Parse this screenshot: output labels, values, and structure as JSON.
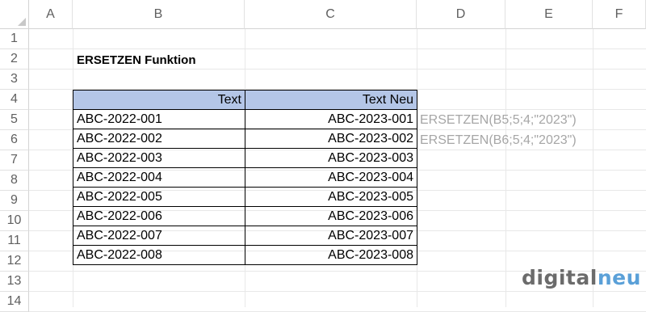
{
  "columns": [
    "A",
    "B",
    "C",
    "D",
    "E",
    "F"
  ],
  "rows": [
    "1",
    "2",
    "3",
    "4",
    "5",
    "6",
    "7",
    "8",
    "9",
    "10",
    "11",
    "12",
    "13",
    "14"
  ],
  "title": "ERSETZEN Funktion",
  "table": {
    "headers": [
      "Text",
      "Text Neu"
    ],
    "rows": [
      [
        "ABC-2022-001",
        "ABC-2023-001"
      ],
      [
        "ABC-2022-002",
        "ABC-2023-002"
      ],
      [
        "ABC-2022-003",
        "ABC-2023-003"
      ],
      [
        "ABC-2022-004",
        "ABC-2023-004"
      ],
      [
        "ABC-2022-005",
        "ABC-2023-005"
      ],
      [
        "ABC-2022-006",
        "ABC-2023-006"
      ],
      [
        "ABC-2022-007",
        "ABC-2023-007"
      ],
      [
        "ABC-2022-008",
        "ABC-2023-008"
      ]
    ]
  },
  "formulas": [
    "ERSETZEN(B5;5;4;\"2023\")",
    "ERSETZEN(B6;5;4;\"2023\")"
  ],
  "logo": {
    "part1": "digital",
    "part2": "neu",
    "color1": "#6b6b6b",
    "color2": "#5aa0d8"
  },
  "colors": {
    "header_fill": "#b4c6e7",
    "formula_text": "#a6a6a6"
  }
}
